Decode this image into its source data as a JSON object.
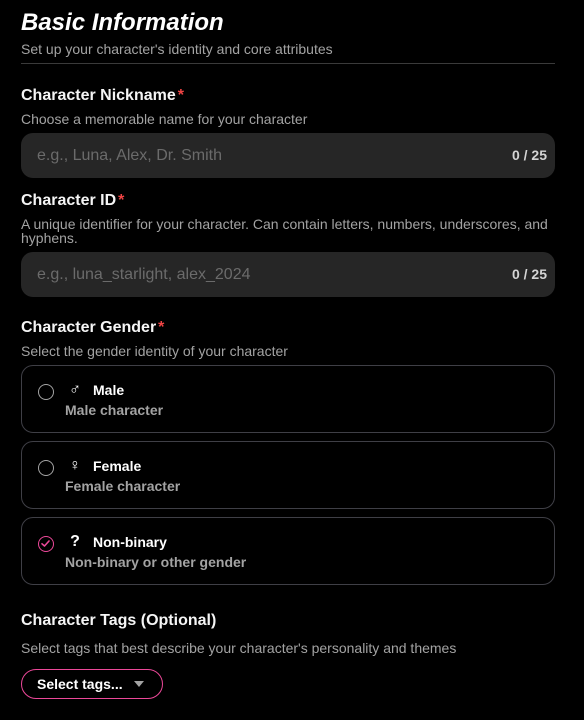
{
  "section": {
    "title": "Basic Information",
    "subtitle": "Set up your character's identity and core attributes"
  },
  "nickname": {
    "label": "Character Nickname",
    "required_mark": "*",
    "help": "Choose a memorable name for your character",
    "placeholder": "e.g., Luna, Alex, Dr. Smith",
    "value": "",
    "counter": "0 / 25"
  },
  "character_id": {
    "label": "Character ID",
    "required_mark": "*",
    "help": "A unique identifier for your character. Can contain letters, numbers, underscores, and hyphens.",
    "placeholder": "e.g., luna_starlight, alex_2024",
    "value": "",
    "counter": "0 / 25"
  },
  "gender": {
    "label": "Character Gender",
    "required_mark": "*",
    "help": "Select the gender identity of your character",
    "selected": "non-binary",
    "options": [
      {
        "id": "male",
        "icon": "♂",
        "icon_name": "male-symbol-icon",
        "label": "Male",
        "description": "Male character"
      },
      {
        "id": "female",
        "icon": "♀",
        "icon_name": "female-symbol-icon",
        "label": "Female",
        "description": "Female character"
      },
      {
        "id": "non-binary",
        "icon": "?",
        "icon_name": "question-mark-icon",
        "label": "Non-binary",
        "description": "Non-binary or other gender"
      }
    ]
  },
  "tags": {
    "label": "Character Tags (Optional)",
    "help": "Select tags that best describe your character's personality and themes",
    "button_label": "Select tags..."
  },
  "colors": {
    "accent": "#ec4899",
    "required": "#ef4444",
    "background": "#000000",
    "input_bg": "#262626"
  }
}
